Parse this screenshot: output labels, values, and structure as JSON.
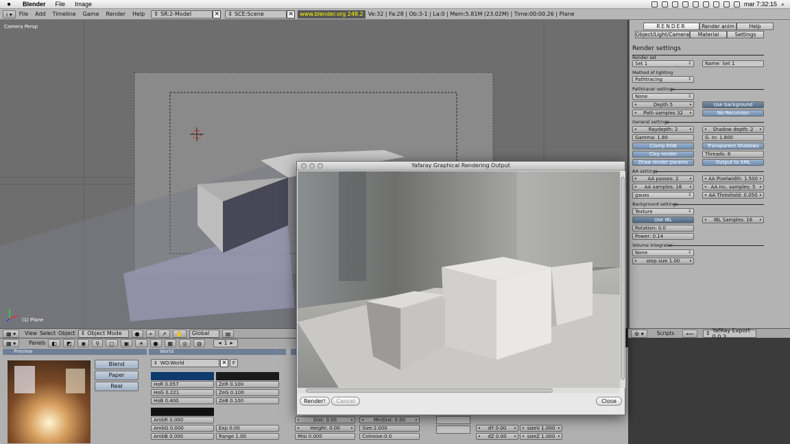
{
  "menubar": {
    "app_name": "Blender",
    "items": [
      "File",
      "Image"
    ],
    "clock": "mar 7:32:15"
  },
  "header": {
    "menus": [
      "File",
      "Add",
      "Timeline",
      "Game",
      "Render",
      "Help"
    ],
    "screen": "SR:2-Model",
    "scene": "SCE:Scene",
    "url": "www.blender.org 248.2",
    "stats": "Ve:32 | Fa:28 | Ob:3-1 | La:0  | Mem:5.81M (23.02M)  | Time:00:00.26 | Plane"
  },
  "viewport": {
    "label": "Camera Persp",
    "object": "(1) Plane"
  },
  "render_panel": {
    "tabs_row1": [
      "RENDER",
      "Render anim",
      "Help"
    ],
    "tabs_row2": [
      "Object/Light/Camera",
      "Material",
      "Settings"
    ],
    "title": "Render settings",
    "render_set_label": "Render set",
    "render_set_value": "Set 1",
    "name_value": "Name: Set 1",
    "lighting_label": "Method of lighting",
    "lighting_value": "Pathtracing",
    "pt_label": "Pathtracer settings",
    "pt_value": "None",
    "depth": "Depth 5",
    "use_background": "Use background",
    "path_samples": "Path samples 32",
    "no_recursion": "No Recursion",
    "general_label": "General settings",
    "raydepth": "Raydepth: 2",
    "shadow_depth": "Shadow depth: 2",
    "gamma": "Gamma: 1.80",
    "gin": "G. In: 1.800",
    "clamp_rgb": "Clamp RGB",
    "transparent_shadows": "Transparent Shadows",
    "clay_render": "Clay render",
    "threads": "Threads: 8",
    "draw_params": "Draw render params",
    "output_xml": "Output to XML",
    "aa_label": "AA settings",
    "aa_passes": "AA passes: 2",
    "aa_pixelwidth": "AA Pixelwidth: 1.500",
    "aa_samples": "AA samples: 16",
    "aa_inc": "AA inc. samples: 5",
    "aa_filter": "gauss",
    "aa_threshold": "AA Threshold: 0.050",
    "bg_label": "Background settings",
    "bg_value": "Texture",
    "use_ibl": "Use IBL",
    "ibl_samples": "IBL Samples: 16",
    "rotation": "Rotation: 0.0",
    "power": "Power: 0.14",
    "vol_label": "Volume Integrator",
    "vol_value": "None",
    "step_size": "step size 1.00"
  },
  "scripts_header": {
    "label": "Scripts",
    "script": "YafRay Export 0.0.3"
  },
  "view_header": {
    "items": [
      "View",
      "Select",
      "Object"
    ],
    "mode": "Object Mode",
    "orientation": "Global"
  },
  "buttons_header": {
    "panels": "Panels",
    "frame": "1"
  },
  "preview_panel": {
    "title": "Preview",
    "blend": "Blend",
    "paper": "Paper",
    "real": "Real"
  },
  "world_panel": {
    "title": "World",
    "world_name": "WO:World",
    "f_button": "F",
    "hor": "HoR 0.057",
    "hog": "HoG 0.221",
    "hob": "HoB 0.400",
    "zer": "ZeR 0.100",
    "zeg": "ZeG 0.100",
    "zeb": "ZeB 0.100",
    "ambr": "AmbR 0.000",
    "ambg": "AmbG 0.000",
    "ambb": "AmbB 0.000",
    "exp": "Exp 0.00",
    "range": "Range 1.00"
  },
  "mist_panel": {
    "dist": "Dist: 0.00",
    "height": "Height: 0.00",
    "misi": "Misi 0.000",
    "mindist": "MinDist: 0.00",
    "size": "Size:2.000",
    "colnoise": "Colnoise:0.0"
  },
  "stars_panel": {
    "dy": "dY 0.00",
    "dz": "dZ 0.00",
    "sizev": "sizeV 1.000",
    "sizez": "sizeZ 1.000"
  },
  "dialog": {
    "title": "Yafaray Graphical Rendering Output",
    "render_btn": "Render!",
    "cancel_btn": "Cancel",
    "close_btn": "Close"
  },
  "colors": {
    "blender_panel": "#b3b3b3",
    "toggle_blue": "#6f8db1",
    "url_yellow": "#ffff00"
  }
}
